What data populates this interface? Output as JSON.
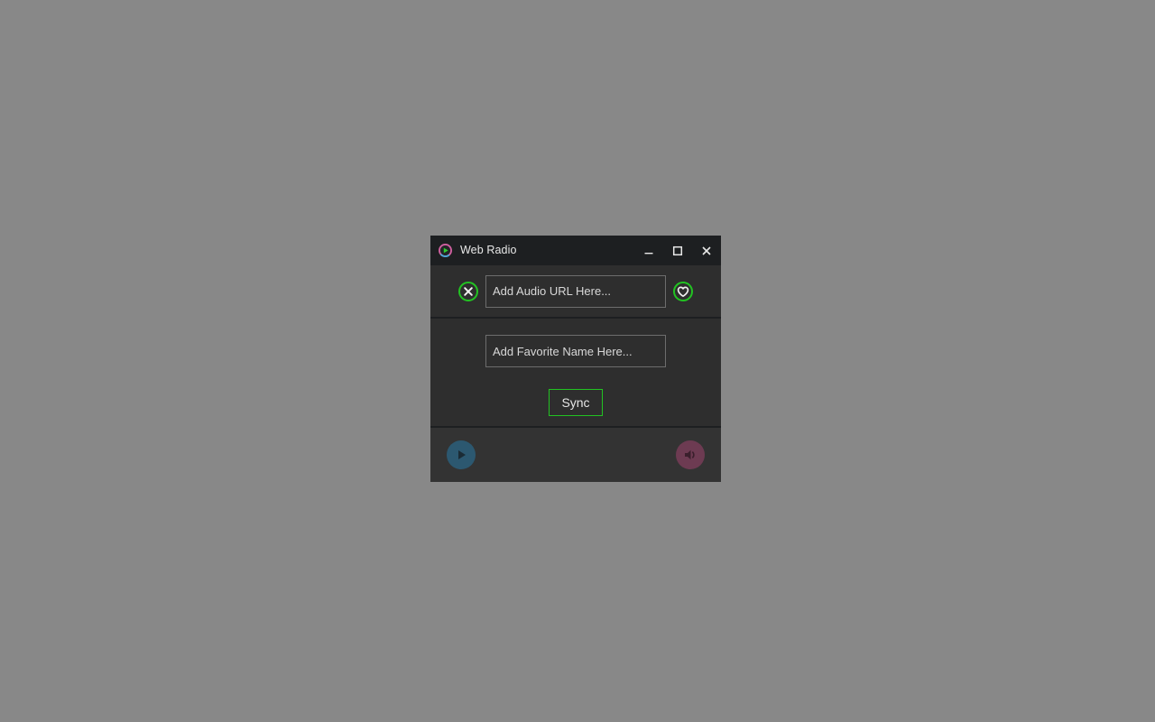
{
  "window": {
    "title": "Web Radio",
    "app_icon": "play-circle-icon",
    "controls": {
      "minimize": "minimize-icon",
      "maximize": "maximize-icon",
      "close": "close-icon"
    }
  },
  "url_panel": {
    "clear_icon": "close-circle-icon",
    "url_input": {
      "value": "",
      "placeholder": "Add Audio URL Here..."
    },
    "favorite_icon": "heart-circle-icon"
  },
  "favorite_panel": {
    "name_input": {
      "value": "",
      "placeholder": "Add Favorite Name Here..."
    },
    "sync_label": "Sync"
  },
  "transport": {
    "play_icon": "play-icon",
    "volume_icon": "volume-icon"
  },
  "colors": {
    "desktop": "#888888",
    "titlebar": "#1d1f21",
    "panel": "#2e2e2e",
    "transport_bar": "#333333",
    "accent_green": "#22c322",
    "accent_pink": "#d060a0",
    "play_button": "#2c5870",
    "volume_button": "#6d3b52",
    "text": "#e6e6e6"
  }
}
